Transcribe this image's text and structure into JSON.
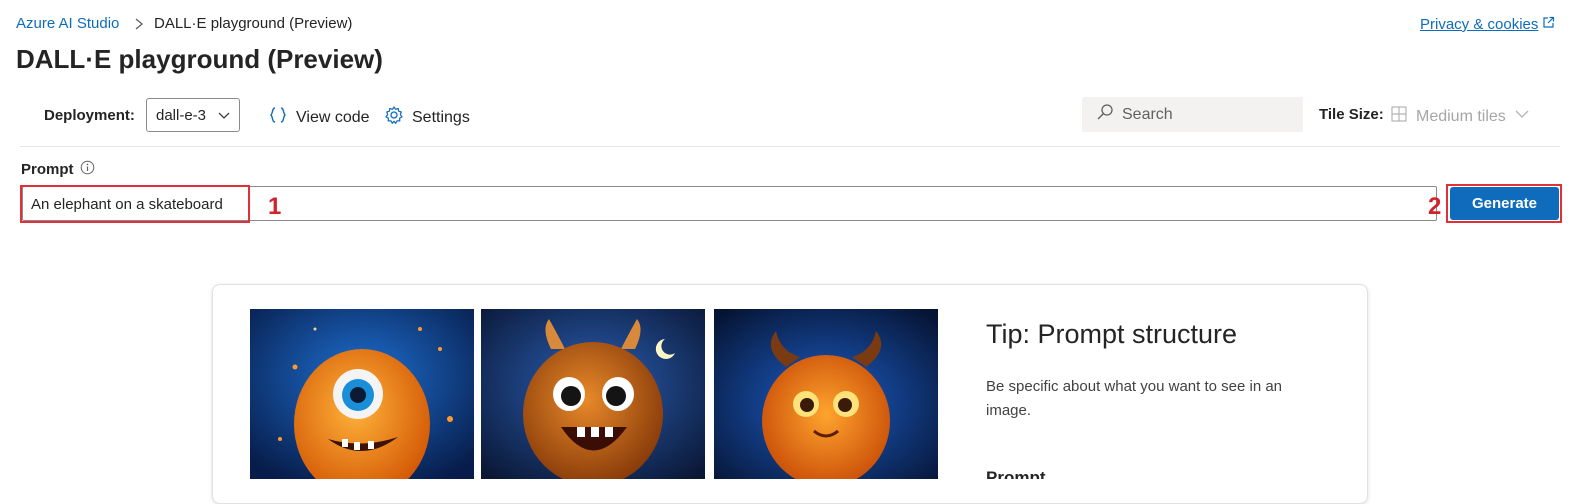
{
  "breadcrumb": {
    "root": "Azure AI Studio",
    "current": "DALL·E playground (Preview)"
  },
  "privacy_link": "Privacy & cookies",
  "page_title": "DALL·E playground (Preview)",
  "toolbar": {
    "deployment_label": "Deployment:",
    "deployment_value": "dall-e-3",
    "view_code": "View code",
    "settings": "Settings",
    "search_placeholder": "Search",
    "tile_size_label": "Tile Size:",
    "tile_size_value": "Medium tiles"
  },
  "prompt": {
    "label": "Prompt",
    "value": "An elephant on a skateboard",
    "generate": "Generate"
  },
  "annotations": {
    "step1": "1",
    "step2": "2"
  },
  "tip": {
    "title": "Tip: Prompt structure",
    "body": "Be specific about what you want to see in an image.",
    "next_heading": "Prompt"
  },
  "colors": {
    "accent": "#0f6cbd",
    "highlight": "#e0313b",
    "annotation_text": "#d2232a"
  },
  "icons": [
    "chevron-right-icon",
    "external-link-icon",
    "chevron-down-icon",
    "braces-icon",
    "gear-icon",
    "search-icon",
    "grid-icon",
    "info-icon"
  ]
}
